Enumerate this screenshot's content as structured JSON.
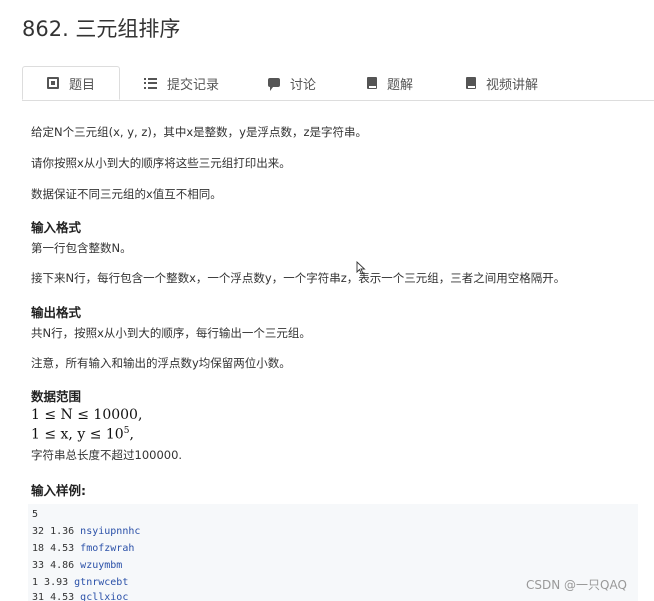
{
  "problem": {
    "title": "862. 三元组排序"
  },
  "tabs": [
    {
      "label": "题目",
      "icon": "book-icon",
      "active": true
    },
    {
      "label": "提交记录",
      "icon": "list-icon",
      "active": false
    },
    {
      "label": "讨论",
      "icon": "chat-icon",
      "active": false
    },
    {
      "label": "题解",
      "icon": "book-icon",
      "active": false
    },
    {
      "label": "视频讲解",
      "icon": "book-icon",
      "active": false
    }
  ],
  "description": {
    "p1": "给定N个三元组(x, y, z)，其中x是整数，y是浮点数，z是字符串。",
    "p2": "请你按照x从小到大的顺序将这些三元组打印出来。",
    "p3": "数据保证不同三元组的x值互不相同。"
  },
  "input_format": {
    "heading": "输入格式",
    "p1": "第一行包含整数N。",
    "p2": "接下来N行，每行包含一个整数x，一个浮点数y，一个字符串z，表示一个三元组，三者之间用空格隔开。"
  },
  "output_format": {
    "heading": "输出格式",
    "p1": "共N行，按照x从小到大的顺序，每行输出一个三元组。",
    "p2": "注意，所有输入和输出的浮点数y均保留两位小数。"
  },
  "data_range": {
    "heading": "数据范围",
    "line1": "1 ≤ N ≤ 10000,",
    "line2_prefix": "1 ≤ x, y ≤ 10",
    "line2_exp": "5",
    "line2_suffix": ",",
    "note": "字符串总长度不超过100000."
  },
  "sample_input": {
    "heading": "输入样例:",
    "lines": [
      {
        "num": "5",
        "rest": "",
        "str": ""
      },
      {
        "num": "32",
        "rest": " 1.36 ",
        "str": "nsyiupnnhc"
      },
      {
        "num": "18",
        "rest": " 4.53 ",
        "str": "fmofzwrah"
      },
      {
        "num": "33",
        "rest": " 4.86 ",
        "str": "wzuymbm"
      },
      {
        "num": "1",
        "rest": " 3.93 ",
        "str": "gtnrwcebt"
      },
      {
        "num": "31",
        "rest": " 4.53 ",
        "str": "gcllxioc"
      }
    ]
  },
  "watermark": "CSDN @一只QAQ"
}
